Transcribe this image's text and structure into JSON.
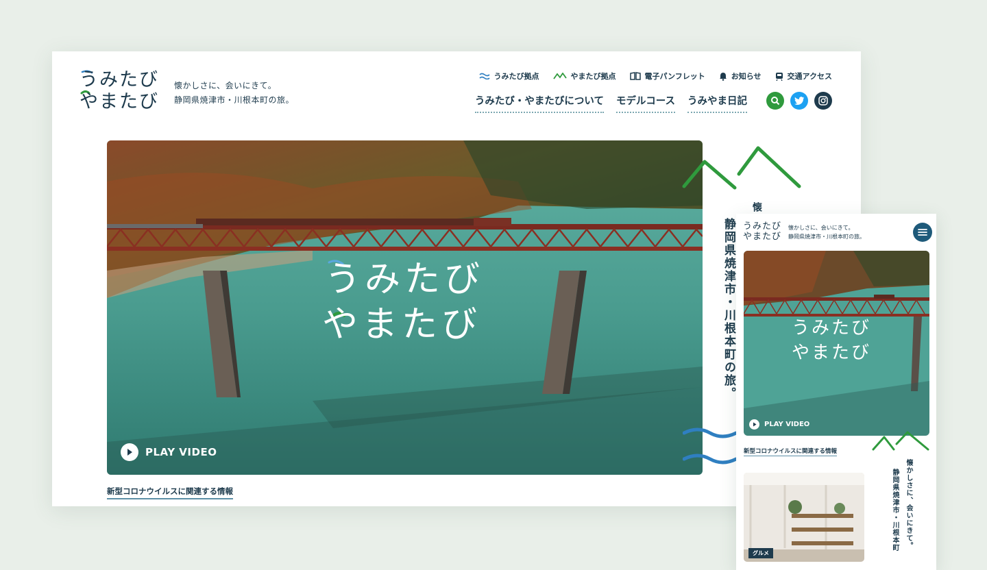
{
  "brand": {
    "logo_line1": "うみたび",
    "logo_line2": "やまたび",
    "tagline_line1": "懐かしさに、会いにきて。",
    "tagline_line2": "静岡県焼津市・川根本町の旅。"
  },
  "util_nav": [
    {
      "label": "うみたび拠点",
      "icon": "wave-icon"
    },
    {
      "label": "やまたび拠点",
      "icon": "mountain-icon"
    },
    {
      "label": "電子パンフレット",
      "icon": "book-icon"
    },
    {
      "label": "お知らせ",
      "icon": "bell-icon"
    },
    {
      "label": "交通アクセス",
      "icon": "train-icon"
    }
  ],
  "main_nav": [
    {
      "label": "うみたび・やまたびについて"
    },
    {
      "label": "モデルコース"
    },
    {
      "label": "うみやま日記"
    }
  ],
  "hero": {
    "play_label": "PLAY VIDEO"
  },
  "covid_link": "新型コロナウイルスに関連する情報",
  "side_text_top": "懐",
  "side_text": "静岡県焼津市・川根本町の旅。",
  "mobile": {
    "play_label": "PLAY VIDEO",
    "covid_link": "新型コロナウイルスに関連する情報",
    "side_text_1": "懐かしさに、会いにきて。",
    "side_text_2": "静岡県焼津市・川根本町",
    "card_badge": "グルメ"
  },
  "colors": {
    "brand_navy": "#1e3b4d",
    "brand_green": "#2f9a3d",
    "wave_blue": "#2f7fc1",
    "background": "#e9efe9"
  }
}
